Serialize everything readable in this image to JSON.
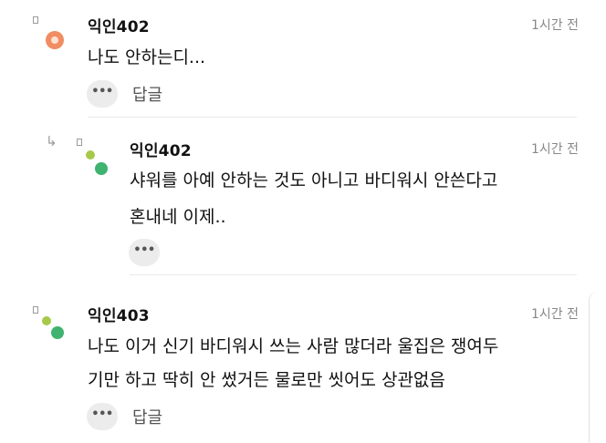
{
  "colors": {
    "avatar_ring": "#f08d62",
    "avatar_green_light": "#a6c94a",
    "avatar_green": "#3fb36f",
    "muted_text": "#888888",
    "divider": "#e9e9e9"
  },
  "icons": {
    "more": "ellipsis-icon",
    "reply_indicator": "reply-arrow-icon"
  },
  "comments": [
    {
      "author": "익인402",
      "time": "1시간 전",
      "lines": [
        "나도 안하는디..."
      ],
      "more_label": "•••",
      "reply_label": "답글",
      "is_reply": false
    },
    {
      "author": "익인402",
      "time": "1시간 전",
      "lines": [
        "샤워를 아예 안하는 것도 아니고 바디워시 안쓴다고",
        "혼내네 이제.."
      ],
      "more_label": "•••",
      "is_reply": true,
      "reply_arrow": "↳"
    },
    {
      "author": "익인403",
      "time": "1시간 전",
      "lines": [
        "나도 이거 신기 바디워시 쓰는 사람 많더라 울집은 쟁여두",
        "기만 하고 딱히 안 썼거든 물로만 씻어도 상관없음"
      ],
      "more_label": "•••",
      "reply_label": "답글",
      "is_reply": false
    }
  ]
}
